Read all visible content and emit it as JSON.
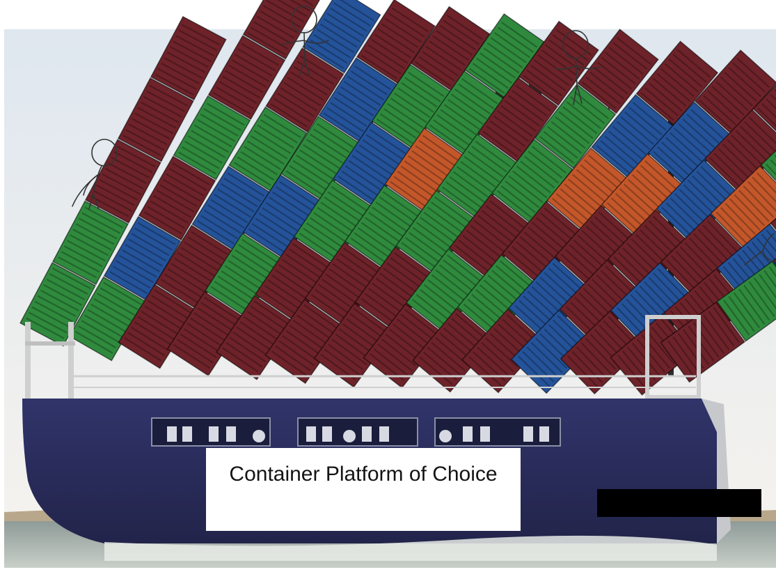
{
  "caption": {
    "text": "Container Platform of Choice"
  },
  "colors": {
    "container_red": "#6e2229",
    "container_green": "#2f8a3d",
    "container_blue": "#24539a",
    "container_orange": "#c4572a",
    "hull": "#2c2e5e",
    "sea": "#9aa8a8",
    "sky": "#eef2f6",
    "redaction": "#000000"
  },
  "figures": [
    {
      "name": "stick-figure-top-left"
    },
    {
      "name": "stick-figure-top-center"
    },
    {
      "name": "stick-figure-top-right"
    },
    {
      "name": "stick-figure-far-right-partial"
    }
  ]
}
